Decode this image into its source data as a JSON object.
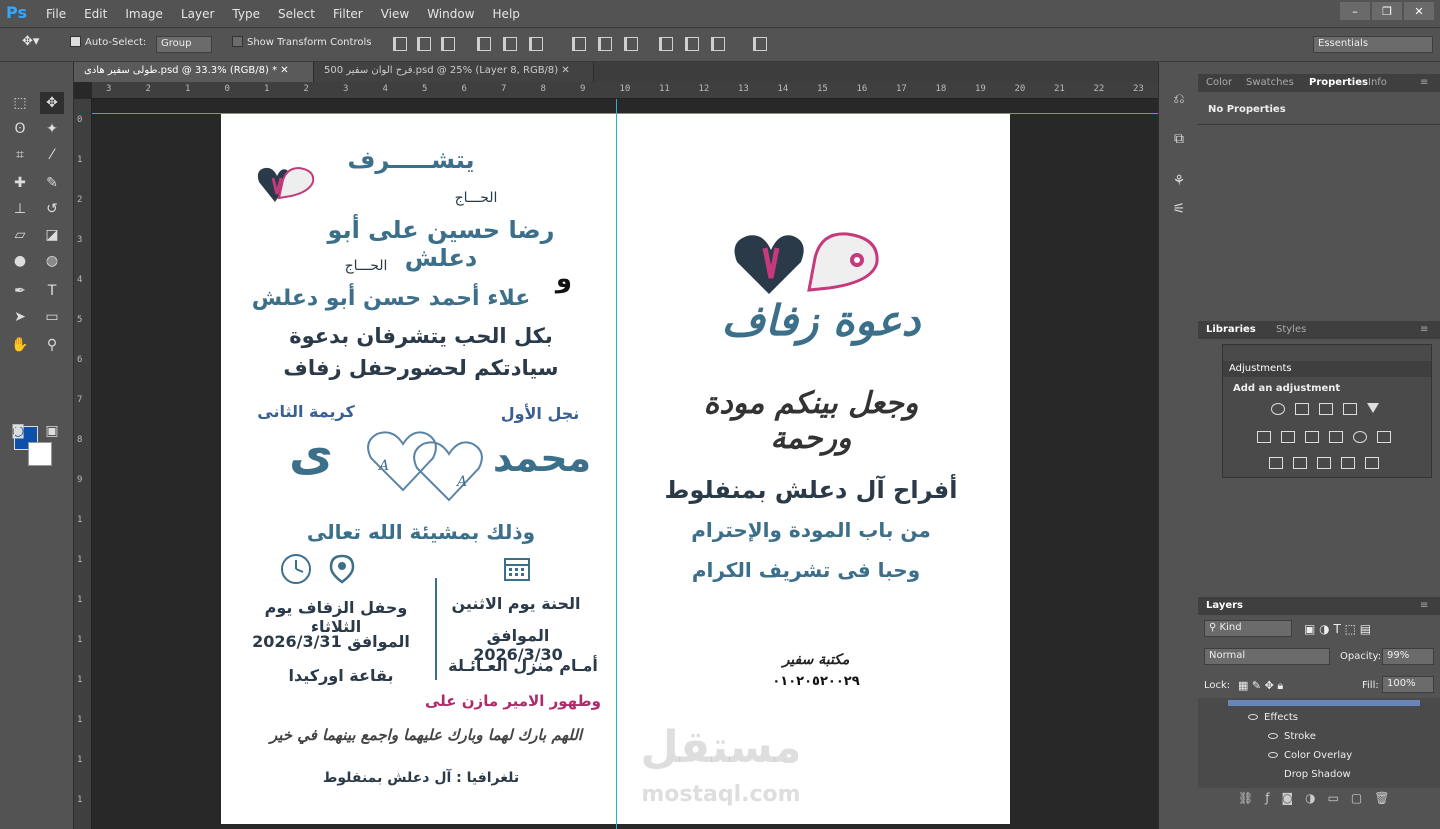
{
  "app": {
    "logo": "Ps"
  },
  "menu": [
    "File",
    "Edit",
    "Image",
    "Layer",
    "Type",
    "Select",
    "Filter",
    "View",
    "Window",
    "Help"
  ],
  "options": {
    "auto_select_label": "Auto-Select:",
    "auto_select_value": "Group",
    "transform_label": "Show Transform Controls",
    "workspace": "Essentials"
  },
  "tabs": [
    {
      "label": "طولى سفير هادى.psd @ 33.3% (RGB/8) *"
    },
    {
      "label": "فرح الوان سفير 500.psd @ 25% (Layer 8, RGB/8)"
    }
  ],
  "ruler": {
    "top": [
      "3",
      "2",
      "1",
      "0",
      "1",
      "2",
      "3",
      "4",
      "5",
      "6",
      "7",
      "8",
      "9",
      "10",
      "11",
      "12",
      "13",
      "14",
      "15",
      "16",
      "17",
      "18",
      "19",
      "20",
      "21",
      "22",
      "23"
    ],
    "left": [
      "0",
      "1",
      "2",
      "3",
      "4",
      "5",
      "6",
      "7",
      "8",
      "9",
      "1",
      "1",
      "1",
      "1",
      "1",
      "1",
      "1",
      "1"
    ]
  },
  "invitation": {
    "left": {
      "line1": "يتشـــــرف",
      "title1": "الحـــاج",
      "name1": "رضا حسين على أبو دعلش",
      "title2": "الحـــاج",
      "and": "و",
      "name2": "علاء أحمد حسن أبو دعلش",
      "invite1": "بكل الحب يتشرفان بدعوة",
      "invite2": "سيادتكم لحضورحفل زفاف",
      "groom_label": "نجل الأول",
      "groom_name": "محمد",
      "bride_label": "كريمة الثانى",
      "bride_initial": "ى",
      "heart_letter": "A",
      "god_will": "وذلك بمشيئة الله تعالى",
      "henna_day": "الحنة يوم الاثنين",
      "henna_date": "الموافق 2026/3/30",
      "henna_place": "أمـام منزل العـائـلة",
      "wedding_day": "وحفل الزفاف يوم الثلاثاء",
      "wedding_date": "الموافق  2026/3/31",
      "wedding_place": "بقاعة اوركيدا",
      "circumcision": "وطهور الامير مازن على",
      "prayer": "اللهم بارك لهما وبارك عليهما واجمع بينهما في خير",
      "telegraph": "تلغرافيا : آل دعلش بمنفلوط"
    },
    "right": {
      "title": "دعوة زفاف",
      "verse": "وجعل بينكم مودة ورحمة",
      "families": "أفراح آل دعلش بمنفلوط",
      "line2": "من باب المودة والإحترام",
      "line3": "وحبا فى تشريف الكرام",
      "print_shop": "مكتبة سفير",
      "phone": "٠١٠٢٠٥٢٠٠٢٩"
    },
    "watermark": {
      "logo": "مستقل",
      "url": "mostaql.com"
    }
  },
  "panels": {
    "top_tabs": [
      "Color",
      "Swatches",
      "Properties",
      "Info"
    ],
    "properties_empty": "No Properties",
    "lib_tabs": [
      "Libraries",
      "Styles"
    ],
    "adjustments_title": "Adjustments",
    "adjustments_hint": "Add an adjustment",
    "layers_tab": "Layers",
    "kind": "Kind",
    "blend": "Normal",
    "opacity_label": "Opacity:",
    "opacity": "99%",
    "lock_label": "Lock:",
    "fill_label": "Fill:",
    "fill": "100%",
    "layer_rows": [
      "Effects",
      "Stroke",
      "Color Overlay",
      "Drop Shadow"
    ]
  },
  "colors": {
    "foreground": "#0e4fa8",
    "background": "#ffffff",
    "accent": "#3c6f8a",
    "pink": "#b0296a"
  }
}
